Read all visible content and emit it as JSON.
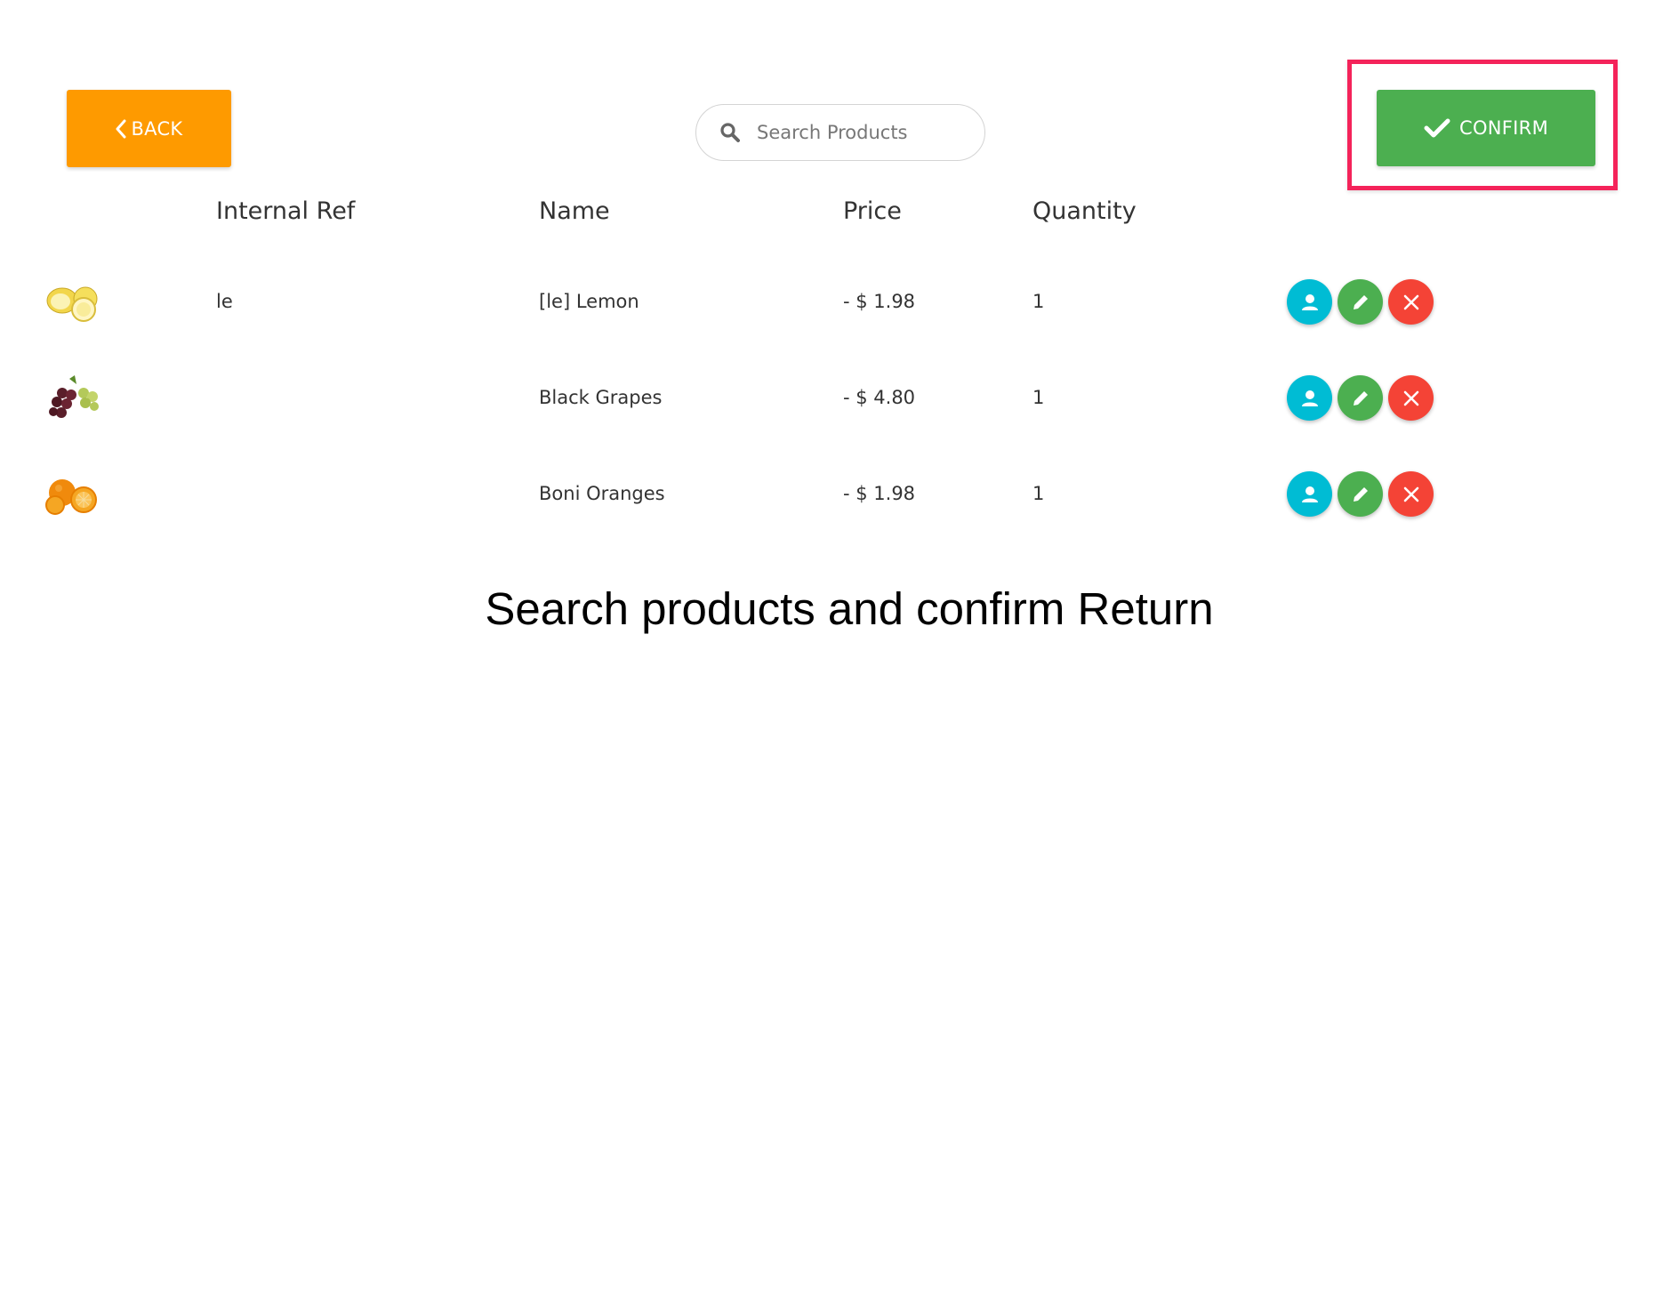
{
  "toolbar": {
    "back_label": "BACK",
    "confirm_label": "CONFIRM"
  },
  "search": {
    "placeholder": "Search Products",
    "value": ""
  },
  "table": {
    "headers": {
      "ref": "Internal Ref",
      "name": "Name",
      "price": "Price",
      "quantity": "Quantity"
    },
    "rows": [
      {
        "image": "lemon",
        "ref": "le",
        "name": "[le] Lemon",
        "price": "- $ 1.98",
        "quantity": "1"
      },
      {
        "image": "grapes",
        "ref": "",
        "name": "Black Grapes",
        "price": "- $ 4.80",
        "quantity": "1"
      },
      {
        "image": "oranges",
        "ref": "",
        "name": "Boni Oranges",
        "price": "- $ 1.98",
        "quantity": "1"
      }
    ]
  },
  "caption": "Search products and confirm Return",
  "colors": {
    "back": "#fe9a00",
    "confirm": "#4caf50",
    "highlight": "#f4235a",
    "user_button": "#00bcd4",
    "edit_button": "#4caf50",
    "delete_button": "#f44336"
  },
  "icons": {
    "back": "chevron-left-icon",
    "confirm": "check-icon",
    "search": "search-icon",
    "user": "user-icon",
    "edit": "pencil-icon",
    "delete": "close-icon"
  }
}
